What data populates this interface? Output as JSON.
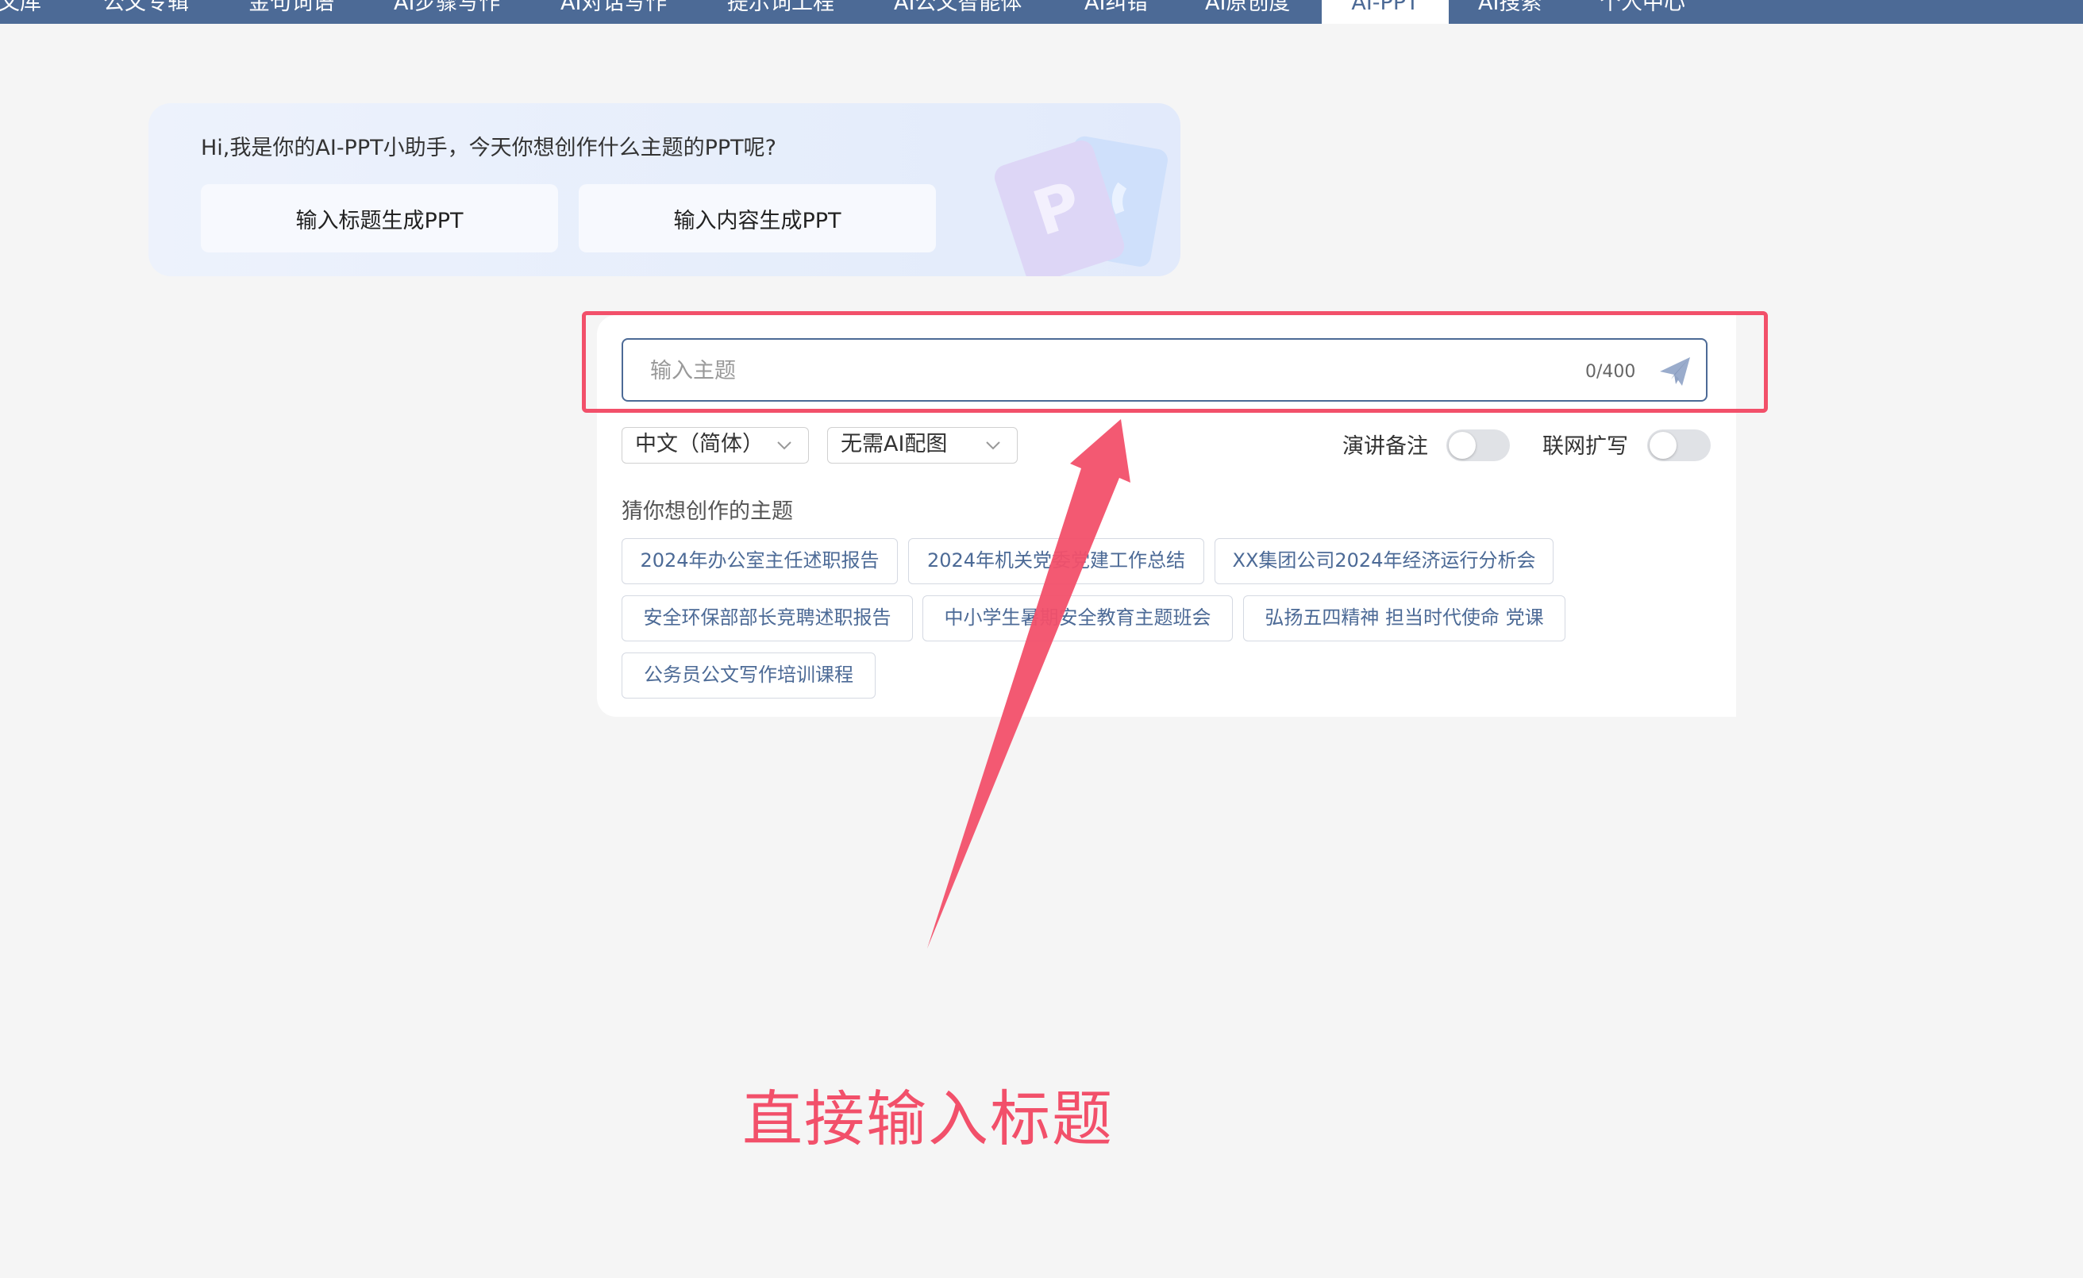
{
  "nav": {
    "items": [
      "文库",
      "公文专辑",
      "金句词语",
      "AI步骤写作",
      "AI对话写作",
      "提示词工程",
      "AI公文智能体",
      "AI纠错",
      "AI原创度",
      "AI-PPT",
      "AI搜索",
      "个人中心"
    ],
    "active": "AI-PPT"
  },
  "welcome": {
    "greeting": "Hi,我是你的AI-PPT小助手，今天你想创作什么主题的PPT呢?",
    "mode_title": "输入标题生成PPT",
    "mode_content": "输入内容生成PPT"
  },
  "topic": {
    "placeholder": "输入主题",
    "value": "",
    "counter": "0/400"
  },
  "options": {
    "language": "中文（简体）",
    "image_mode": "无需AI配图",
    "speaker_notes_label": "演讲备注",
    "speaker_notes_on": false,
    "web_expand_label": "联网扩写",
    "web_expand_on": false
  },
  "suggestions": {
    "title": "猜你想创作的主题",
    "items": [
      "2024年办公室主任述职报告",
      "2024年机关党委党建工作总结",
      "XX集团公司2024年经济运行分析会",
      "安全环保部部长竞聘述职报告",
      "中小学生暑期安全教育主题班会",
      "弘扬五四精神 担当时代使命 党课",
      "公务员公文写作培训课程"
    ]
  },
  "annotation": {
    "text": "直接输入标题",
    "color": "#f2506a"
  },
  "colors": {
    "nav_bg": "#4c6a96",
    "accent": "#4c6a96",
    "highlight": "#f2506a"
  }
}
